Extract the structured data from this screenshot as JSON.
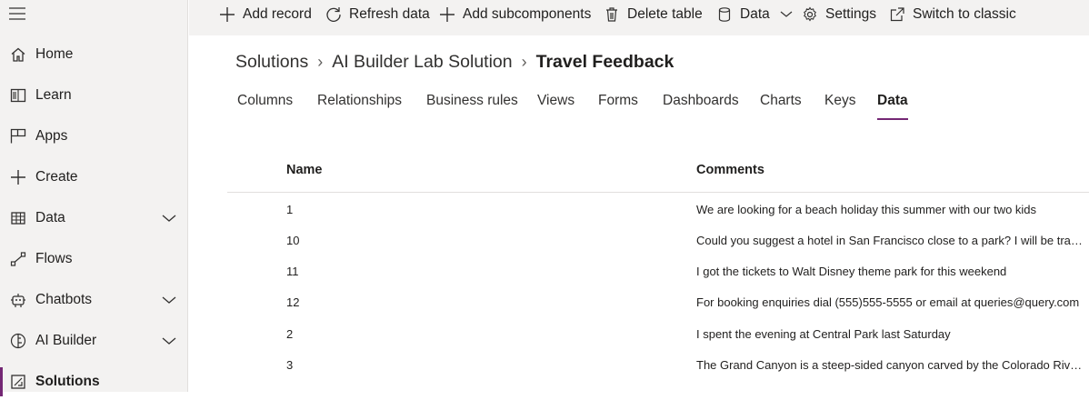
{
  "sidebar": {
    "items": [
      {
        "label": "Home",
        "icon": "home-icon",
        "chevron": false
      },
      {
        "label": "Learn",
        "icon": "book-icon",
        "chevron": false
      },
      {
        "label": "Apps",
        "icon": "apps-icon",
        "chevron": false
      },
      {
        "label": "Create",
        "icon": "plus-icon",
        "chevron": false
      },
      {
        "label": "Data",
        "icon": "table-icon",
        "chevron": true
      },
      {
        "label": "Flows",
        "icon": "flow-icon",
        "chevron": false
      },
      {
        "label": "Chatbots",
        "icon": "bot-icon",
        "chevron": true
      },
      {
        "label": "AI Builder",
        "icon": "brain-icon",
        "chevron": true
      },
      {
        "label": "Solutions",
        "icon": "solutions-icon",
        "chevron": false,
        "selected": true
      }
    ]
  },
  "commandbar": {
    "add_record": "Add record",
    "refresh_data": "Refresh data",
    "add_subcomponents": "Add subcomponents",
    "delete_table": "Delete table",
    "data": "Data",
    "settings": "Settings",
    "switch_to_classic": "Switch to classic"
  },
  "breadcrumb": {
    "root": "Solutions",
    "solution": "AI Builder Lab Solution",
    "current": "Travel Feedback"
  },
  "tabs": [
    "Columns",
    "Relationships",
    "Business rules",
    "Views",
    "Forms",
    "Dashboards",
    "Charts",
    "Keys",
    "Data"
  ],
  "active_tab": "Data",
  "table": {
    "columns": [
      "Name",
      "Comments"
    ],
    "rows": [
      {
        "name": "1",
        "comments": "We are looking for a beach holiday this summer with our two kids"
      },
      {
        "name": "10",
        "comments": "Could you suggest a hotel in San Francisco close to a park? I will be traveli..."
      },
      {
        "name": "11",
        "comments": "I got the tickets to Walt Disney theme park for this weekend"
      },
      {
        "name": "12",
        "comments": "For booking enquiries dial (555)555-5555 or email at queries@query.com"
      },
      {
        "name": "2",
        "comments": "I spent the evening at Central Park last Saturday"
      },
      {
        "name": "3",
        "comments": "The Grand Canyon is a steep-sided canyon carved by the Colorado River i..."
      }
    ]
  },
  "colors": {
    "accent": "#742774",
    "sidebar_bg": "#f3f2f1"
  }
}
